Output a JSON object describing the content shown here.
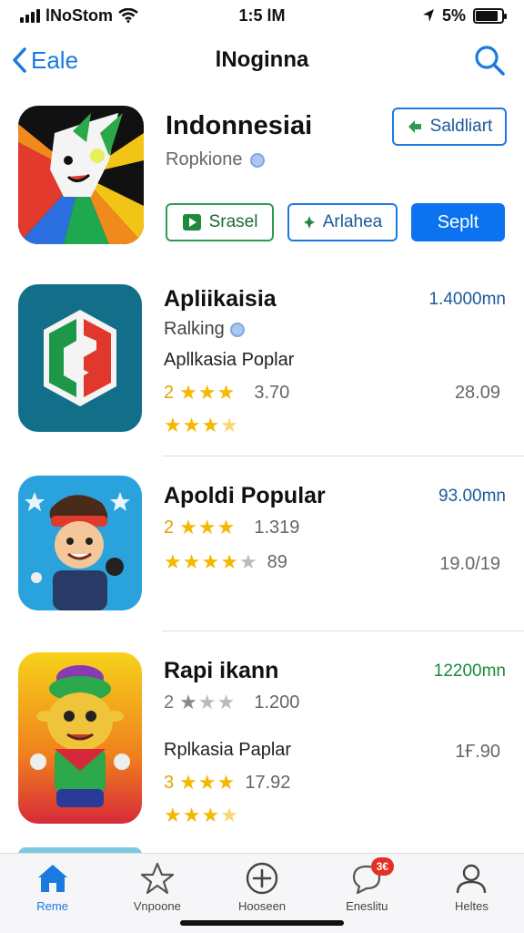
{
  "status": {
    "carrier": "lNoStom",
    "time": "1:5 lM",
    "battery_text": "5%",
    "battery_level": 0.85
  },
  "nav": {
    "back_label": "Eale",
    "title": "lNoginna"
  },
  "featured": {
    "title": "Indonnesiai",
    "subtitle": "Ropkione",
    "top_button": "Saldliart",
    "button_1": "Srasel",
    "button_2": "Arlahea",
    "button_3": "Seplt"
  },
  "apps": [
    {
      "title": "Apliikaisia",
      "price": "1.4000mn",
      "line1_text": "Ralking",
      "line2_text": "Apllkasia Poplar",
      "rank": "2",
      "rating": "3.70",
      "rating_stars": 3,
      "side_num": "28.09",
      "stars_b": 3.5
    },
    {
      "title": "Apoldi Popular",
      "price": "93.00mn",
      "rank": "2",
      "rating": "1.319",
      "rating_stars": 3,
      "count": "89",
      "stars_b": 4,
      "side_num": "19.0/19"
    },
    {
      "title": "Rapi ikann",
      "price": "12200mn",
      "rank": "2",
      "rating": "1.200",
      "rating_stars": 1,
      "line_text": "Rplkasia Paplar",
      "rank2": "3",
      "rating2": "17.92",
      "rating2_stars": 3,
      "side_num": "1Ғ.90",
      "stars_b": 3.5
    }
  ],
  "tabs": [
    {
      "label": "Reme",
      "icon": "home-icon"
    },
    {
      "label": "Vnpoone",
      "icon": "star-icon"
    },
    {
      "label": "Hooseen",
      "icon": "plus-circle-icon"
    },
    {
      "label": "Eneslitu",
      "icon": "chat-bubble-icon",
      "badge": "3€"
    },
    {
      "label": "Heltes",
      "icon": "person-icon"
    }
  ],
  "colors": {
    "accent": "#1a7ae0",
    "solid_button": "#0b72f0",
    "star": "#f5b800",
    "green": "#2e9c4f",
    "badge": "#e53025"
  }
}
